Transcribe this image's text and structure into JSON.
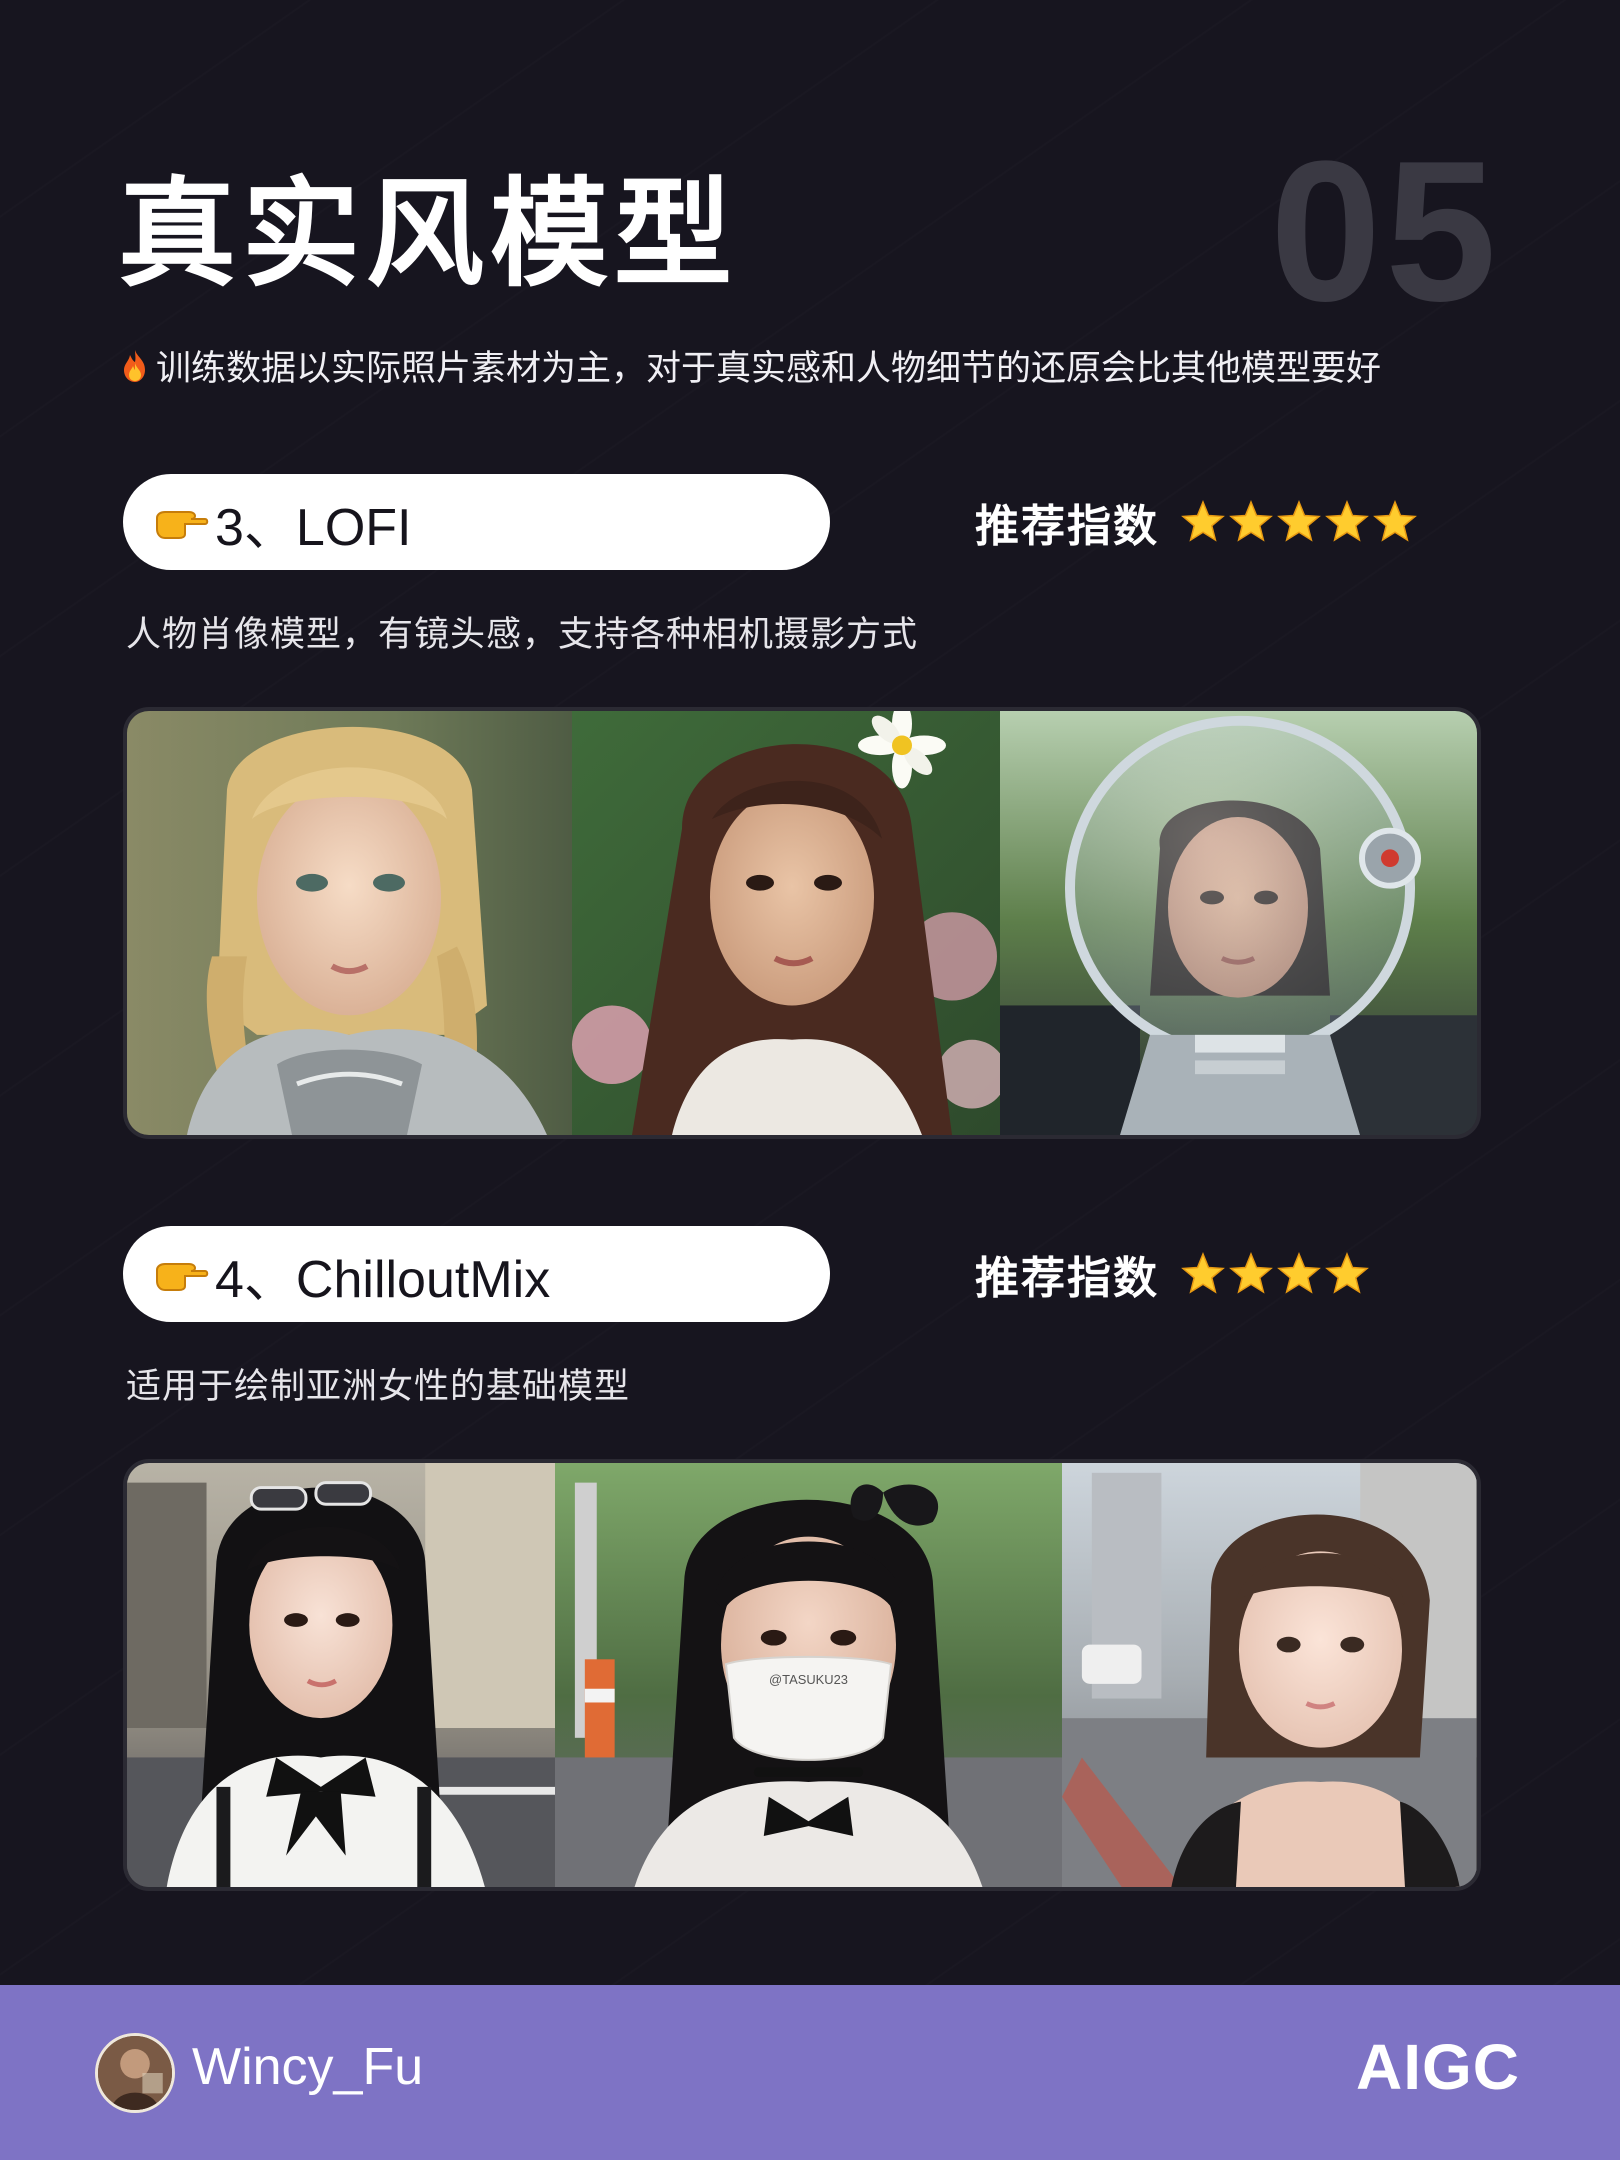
{
  "header": {
    "title": "真实风模型",
    "number": "05",
    "intro": "训练数据以实际照片素材为主，对于真实感和人物细节的还原会比其他模型要好",
    "intro_icon": "fire-icon"
  },
  "models": [
    {
      "label": "3、LOFI",
      "label_icon": "pointing-hand-icon",
      "rating_label": "推荐指数",
      "rating_stars": 5,
      "description": "人物肖像模型，有镜头感，支持各种相机摄影方式",
      "images": [
        "portrait-blonde-braids-armor",
        "portrait-brunette-flower",
        "portrait-astronaut-helmet"
      ]
    },
    {
      "label": "4、ChilloutMix",
      "label_icon": "pointing-hand-icon",
      "rating_label": "推荐指数",
      "rating_stars": 4,
      "description": "适用于绘制亚洲女性的基础模型",
      "images": [
        "portrait-street-bow-tie",
        "portrait-street-mask",
        "portrait-street-bob-hair"
      ],
      "mask_text": "@TASUKU23"
    }
  ],
  "footer": {
    "username": "Wincy_Fu",
    "brand": "AIGC",
    "background": "#7e73c5"
  }
}
